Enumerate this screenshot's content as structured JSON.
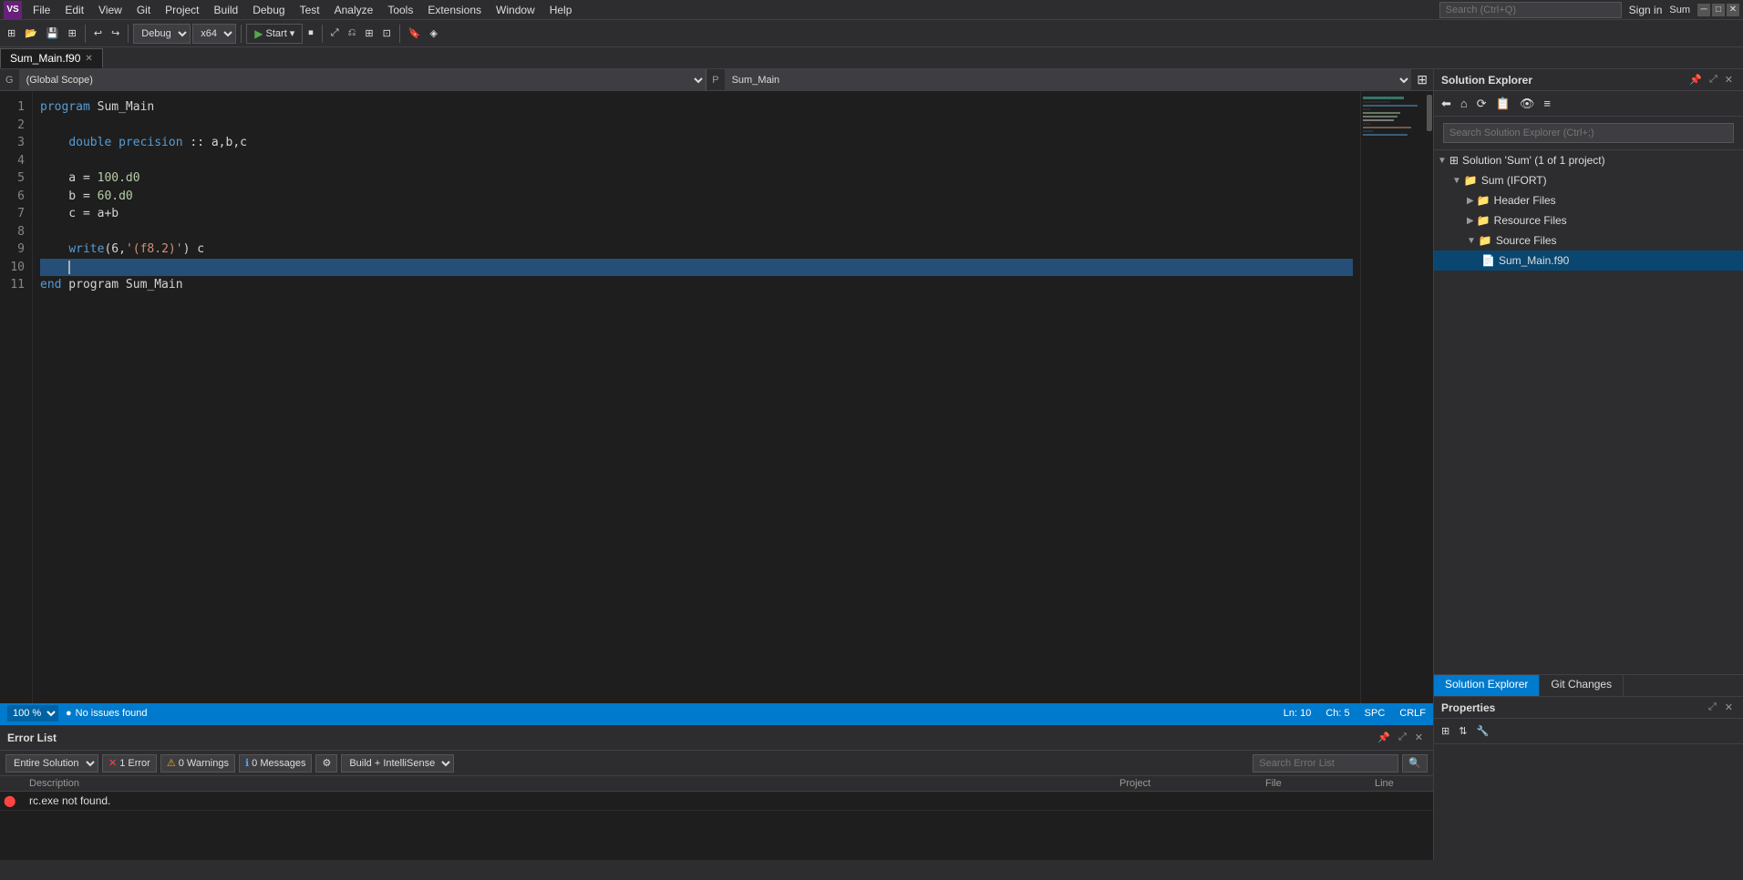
{
  "app": {
    "title": "Sum",
    "logo": "VS"
  },
  "menu": {
    "items": [
      "File",
      "Edit",
      "View",
      "Git",
      "Project",
      "Build",
      "Debug",
      "Test",
      "Analyze",
      "Tools",
      "Extensions",
      "Window",
      "Help"
    ]
  },
  "toolbar": {
    "debug_config": "Debug",
    "platform": "x64",
    "start_label": "Start",
    "undo_label": "⟲",
    "redo_label": "⟳"
  },
  "editor": {
    "tab_title": "Sum_Main.f90",
    "scope_left_label": "G",
    "scope_left_value": "(Global Scope)",
    "scope_right_label": "P",
    "scope_right_value": "Sum_Main",
    "lines": [
      {
        "num": 1,
        "content": "program Sum_Main",
        "tokens": [
          {
            "text": "program",
            "cls": "kw-blue"
          },
          {
            "text": " Sum_Main",
            "cls": ""
          }
        ]
      },
      {
        "num": 2,
        "content": "",
        "tokens": []
      },
      {
        "num": 3,
        "content": "    double precision :: a,b,c",
        "tokens": [
          {
            "text": "    ",
            "cls": ""
          },
          {
            "text": "double precision",
            "cls": "kw-blue"
          },
          {
            "text": " :: a,b,c",
            "cls": ""
          }
        ]
      },
      {
        "num": 4,
        "content": "",
        "tokens": []
      },
      {
        "num": 5,
        "content": "    a = 100.d0",
        "tokens": [
          {
            "text": "    a = ",
            "cls": ""
          },
          {
            "text": "100.d0",
            "cls": "num"
          }
        ]
      },
      {
        "num": 6,
        "content": "    b = 60.d0",
        "tokens": [
          {
            "text": "    b = ",
            "cls": ""
          },
          {
            "text": "60.d0",
            "cls": "num"
          }
        ]
      },
      {
        "num": 7,
        "content": "    c = a+b",
        "tokens": [
          {
            "text": "    c = a+b",
            "cls": ""
          }
        ]
      },
      {
        "num": 8,
        "content": "",
        "tokens": []
      },
      {
        "num": 9,
        "content": "    write(6,'(f8.2)') c",
        "tokens": [
          {
            "text": "    ",
            "cls": ""
          },
          {
            "text": "write",
            "cls": "kw-blue"
          },
          {
            "text": "(6,",
            "cls": ""
          },
          {
            "text": "'(f8.2)'",
            "cls": "str"
          },
          {
            "text": ") c",
            "cls": ""
          }
        ]
      },
      {
        "num": 10,
        "content": "    |",
        "tokens": [
          {
            "text": "    |",
            "cls": ""
          }
        ]
      },
      {
        "num": 11,
        "content": "end program Sum_Main",
        "tokens": [
          {
            "text": "end",
            "cls": "kw-blue"
          },
          {
            "text": " program Sum_Main",
            "cls": ""
          }
        ]
      }
    ]
  },
  "status_bar": {
    "zoom": "100 %",
    "no_issues": "No issues found",
    "ln": "Ln: 10",
    "ch": "Ch: 5",
    "spc": "SPC",
    "crlf": "CRLF"
  },
  "solution_explorer": {
    "title": "Solution Explorer",
    "search_placeholder": "Search Solution Explorer (Ctrl+;)",
    "tree": [
      {
        "level": 0,
        "label": "Solution 'Sum' (1 of 1 project)",
        "type": "solution",
        "expanded": true
      },
      {
        "level": 1,
        "label": "Sum (IFORT)",
        "type": "project",
        "expanded": true
      },
      {
        "level": 2,
        "label": "Header Files",
        "type": "folder",
        "expanded": false
      },
      {
        "level": 2,
        "label": "Resource Files",
        "type": "folder",
        "expanded": false
      },
      {
        "level": 2,
        "label": "Source Files",
        "type": "folder",
        "expanded": true
      },
      {
        "level": 3,
        "label": "Sum_Main.f90",
        "type": "file",
        "selected": true
      }
    ]
  },
  "bottom_tabs": {
    "tabs": [
      "Solution Explorer",
      "Git Changes"
    ]
  },
  "properties": {
    "title": "Properties"
  },
  "error_list": {
    "title": "Error List",
    "filter_options": [
      "Entire Solution"
    ],
    "filter_selected": "Entire Solution",
    "error_count": "1 Error",
    "warning_count": "0 Warnings",
    "message_count": "0 Messages",
    "build_filter": "Build + IntelliSense",
    "search_placeholder": "Search Error List",
    "columns": [
      "",
      "Description",
      "Project",
      "File",
      "Line"
    ],
    "errors": [
      {
        "type": "error",
        "description": "rc.exe not found.",
        "project": "",
        "file": "",
        "line": ""
      }
    ]
  }
}
